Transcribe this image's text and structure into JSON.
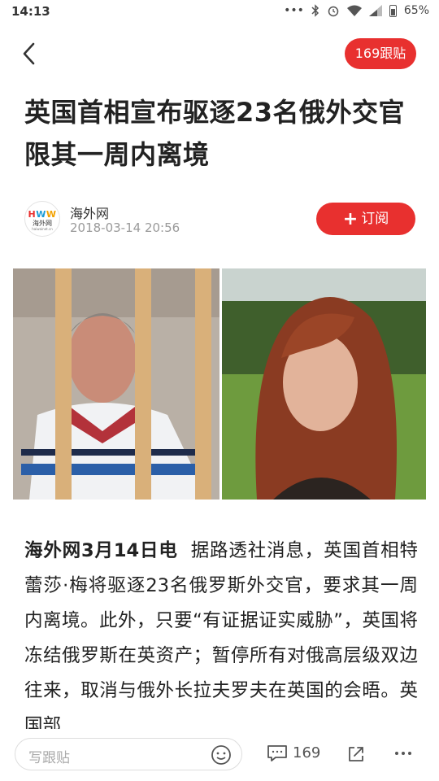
{
  "status_bar": {
    "time": "14:13",
    "battery": "65%"
  },
  "header": {
    "reply_count_label": "169跟贴"
  },
  "article": {
    "title": "英国首相宣布驱逐23名俄外交官 限其一周内离境",
    "source_name": "海外网",
    "publish_time": "2018-03-14 20:56",
    "subscribe_label": "订阅",
    "logo_text": "海外网",
    "logo_domain": "haiwainet.cn",
    "body_lead": "海外网3月14日电",
    "body_text": "据路透社消息，英国首相特蕾莎·梅将驱逐23名俄罗斯外交官，要求其一周内离境。此外，只要“有证据证实威胁”，英国将冻结俄罗斯在英资产；暂停所有对俄高层级双边往来，取消与俄外长拉夫罗夫在英国的会晤。英国部"
  },
  "bottom_bar": {
    "comment_placeholder": "写跟贴",
    "comment_count": "169"
  },
  "colors": {
    "accent": "#e8302f"
  }
}
